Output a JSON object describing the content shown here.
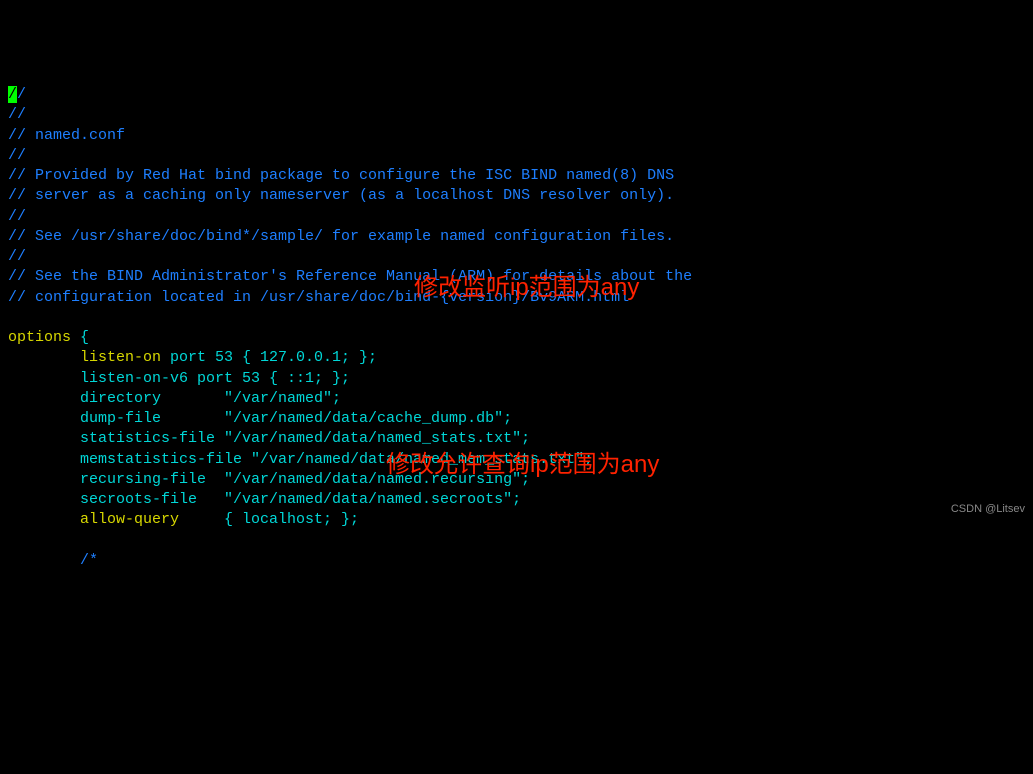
{
  "cursor": "/",
  "comments": {
    "l1": "/",
    "l2": "//",
    "l3": "// named.conf",
    "l4": "//",
    "l5": "// Provided by Red Hat bind package to configure the ISC BIND named(8) DNS",
    "l6": "// server as a caching only nameserver (as a localhost DNS resolver only).",
    "l7": "//",
    "l8": "// See /usr/share/doc/bind*/sample/ for example named configuration files.",
    "l9": "//",
    "l10": "// See the BIND Administrator's Reference Manual (ARM) for details about the",
    "l11": "// configuration located in /usr/share/doc/bind-{version}/Bv9ARM.html"
  },
  "options_kw": "options",
  "brace_open": " {",
  "directives": {
    "listen_on": {
      "label": "listen-on",
      "rest": " port 53 { 127.0.0.1; };"
    },
    "listen_on_v6": {
      "label": "listen-on-v6 port 53 { ::1; };"
    },
    "directory": {
      "label": "directory       \"/var/named\";"
    },
    "dump_file": {
      "label": "dump-file       \"/var/named/data/cache_dump.db\";"
    },
    "statistics_file": {
      "label": "statistics-file \"/var/named/data/named_stats.txt\";"
    },
    "memstatistics_file": {
      "label": "memstatistics-file \"/var/named/data/named_mem_stats.txt\";"
    },
    "recursing_file": {
      "label": "recursing-file  \"/var/named/data/named.recursing\";"
    },
    "secroots_file": {
      "label": "secroots-file   \"/var/named/data/named.secroots\";"
    },
    "allow_query": {
      "label": "allow-query",
      "rest": "     { localhost; };"
    }
  },
  "block_comment_start": "/*",
  "annotations": {
    "a1": "修改监听ip范围为any",
    "a2": "修改允许查询ip范围为any"
  },
  "watermark": "CSDN @Litsev"
}
